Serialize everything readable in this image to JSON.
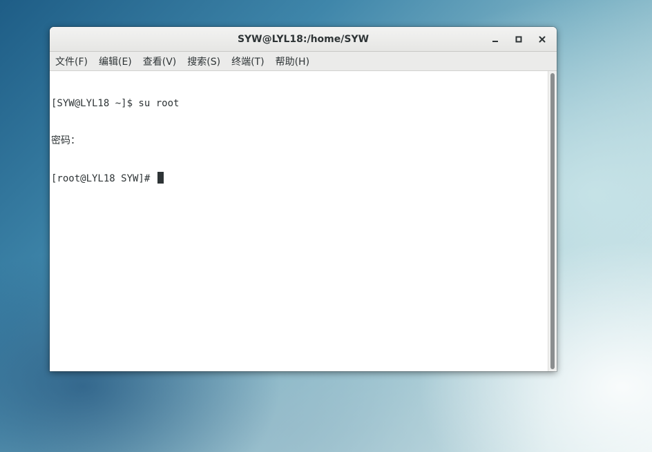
{
  "window": {
    "title": "SYW@LYL18:/home/SYW",
    "controls": {
      "minimize_icon": "minimize-icon",
      "maximize_icon": "maximize-icon",
      "close_icon": "close-icon"
    }
  },
  "menubar": {
    "items": [
      {
        "label": "文件(F)"
      },
      {
        "label": "编辑(E)"
      },
      {
        "label": "查看(V)"
      },
      {
        "label": "搜索(S)"
      },
      {
        "label": "终端(T)"
      },
      {
        "label": "帮助(H)"
      }
    ]
  },
  "terminal": {
    "lines": [
      {
        "text": "[SYW@LYL18 ~]$ su root"
      },
      {
        "text": "密码："
      },
      {
        "text": "[root@LYL18 SYW]# "
      }
    ]
  },
  "colors": {
    "text": "#2e3436",
    "titlebar": "#e8e8e7",
    "terminal_bg": "#ffffff"
  }
}
